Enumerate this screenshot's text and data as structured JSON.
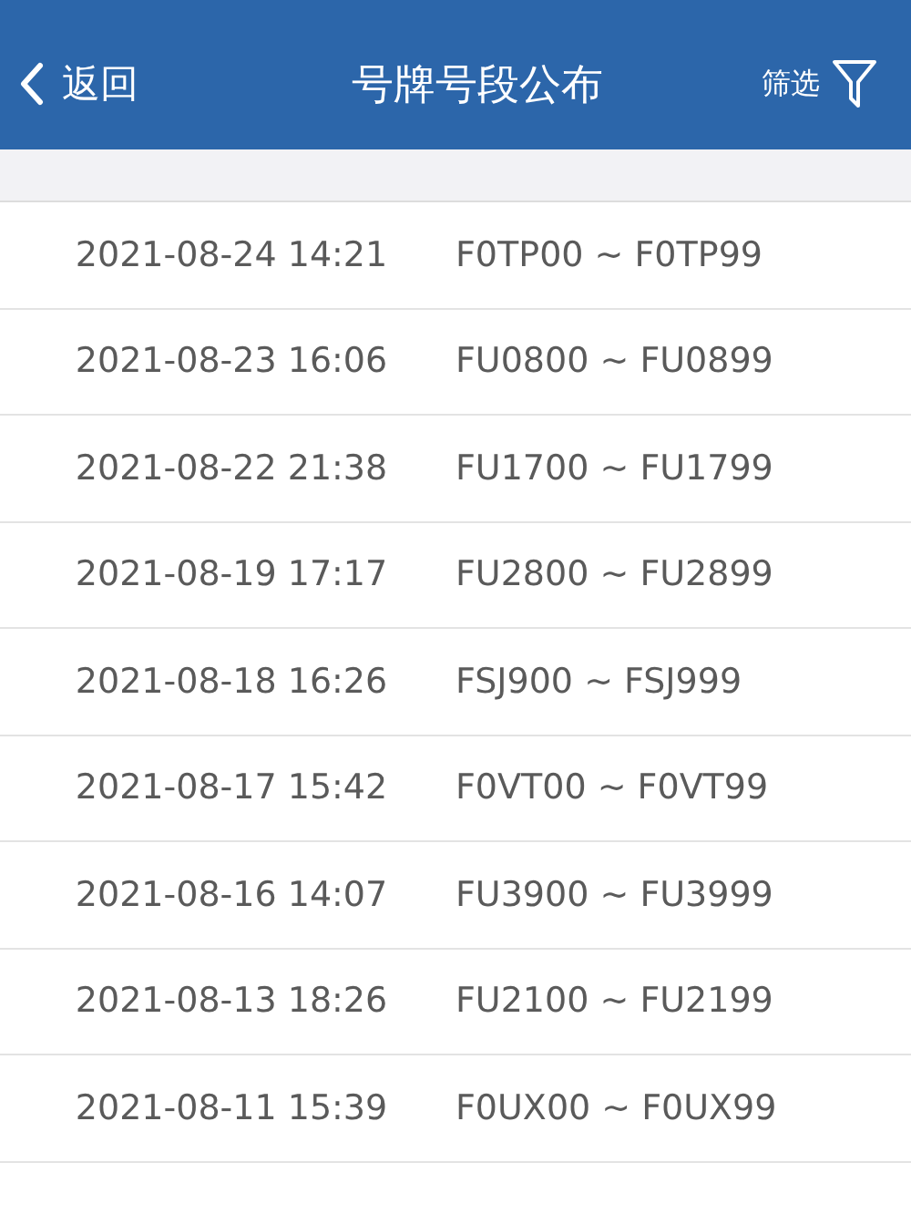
{
  "nav": {
    "back": "返回",
    "title": "号牌号段公布",
    "filter": "筛选"
  },
  "rows": [
    {
      "date": "2021-08-24 14:21",
      "range": "F0TP00 ~ F0TP99"
    },
    {
      "date": "2021-08-23 16:06",
      "range": "FU0800 ~ FU0899"
    },
    {
      "date": "2021-08-22 21:38",
      "range": "FU1700 ~ FU1799"
    },
    {
      "date": "2021-08-19 17:17",
      "range": "FU2800 ~ FU2899"
    },
    {
      "date": "2021-08-18 16:26",
      "range": "FSJ900 ~ FSJ999"
    },
    {
      "date": "2021-08-17 15:42",
      "range": "F0VT00 ~ F0VT99"
    },
    {
      "date": "2021-08-16 14:07",
      "range": "FU3900 ~ FU3999"
    },
    {
      "date": "2021-08-13 18:26",
      "range": "FU2100 ~ FU2199"
    },
    {
      "date": "2021-08-11 15:39",
      "range": "F0UX00 ~ F0UX99"
    }
  ]
}
